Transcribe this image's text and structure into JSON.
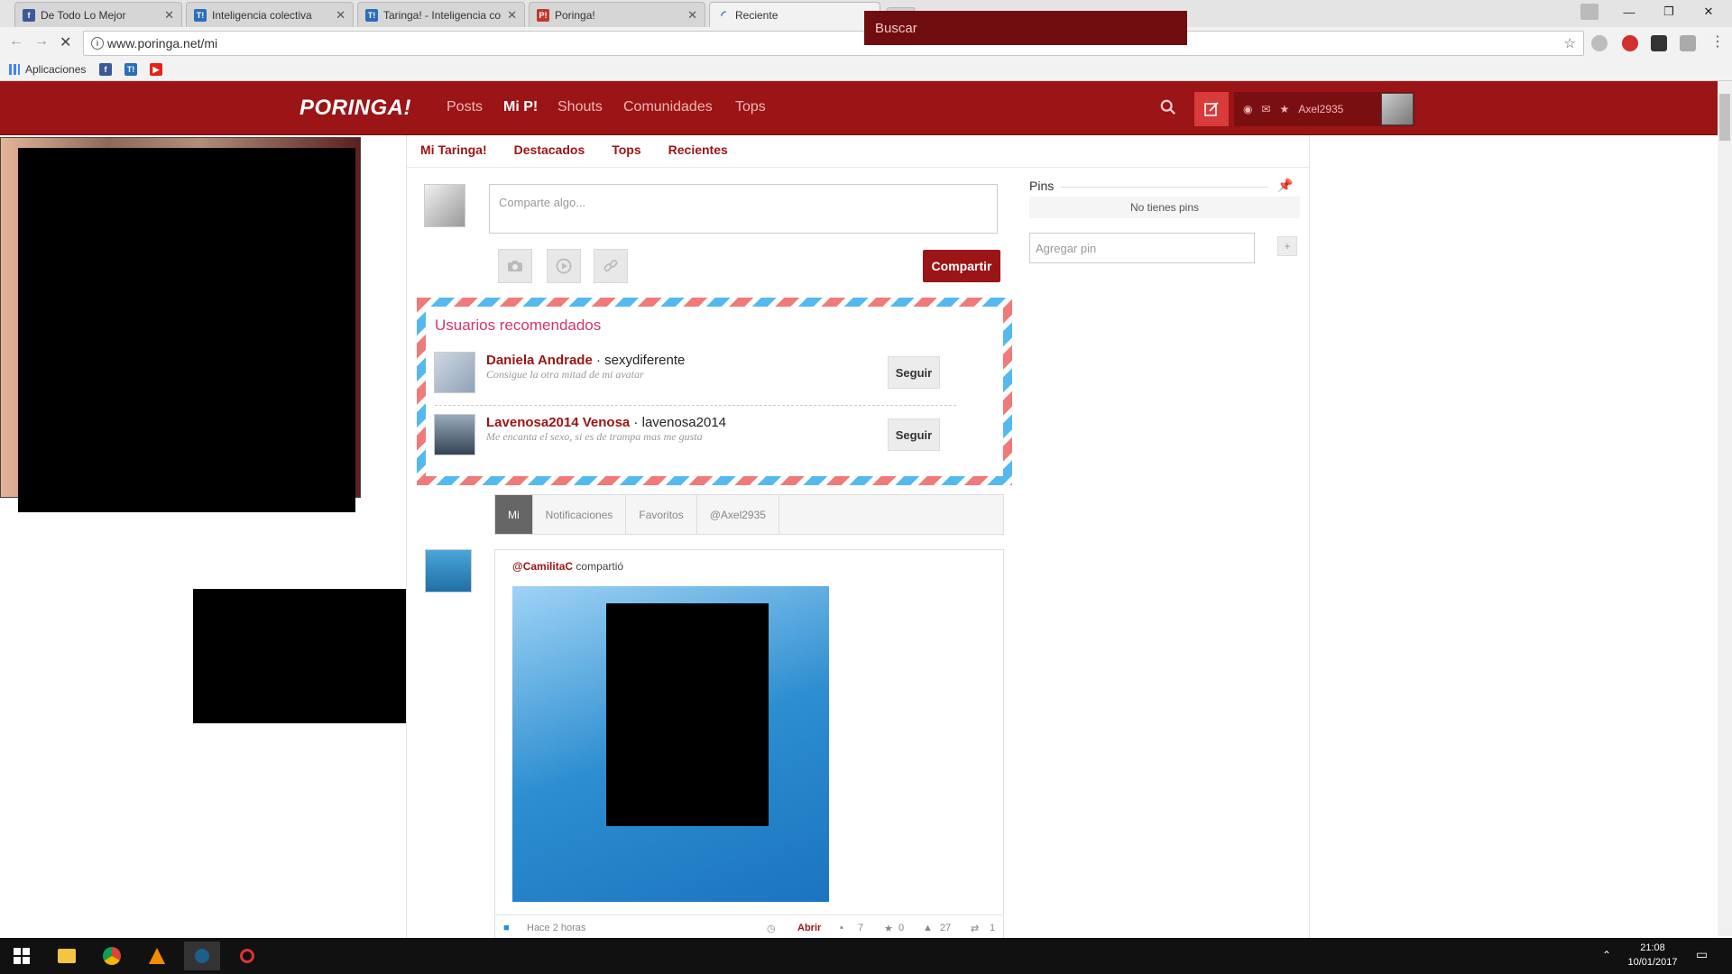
{
  "browser": {
    "tabs": [
      {
        "label": "De Todo Lo Mejor",
        "icon": "facebook-icon",
        "active": false
      },
      {
        "label": "Inteligencia colectiva",
        "icon": "taringa-icon",
        "active": false
      },
      {
        "label": "Taringa! - Inteligencia co",
        "icon": "taringa-icon",
        "active": false
      },
      {
        "label": "Poringa!",
        "icon": "poringa-icon",
        "active": false
      },
      {
        "label": "Reciente",
        "icon": "loading-icon",
        "active": true
      }
    ],
    "url": "www.poringa.net/mi",
    "bookmarks": {
      "apps_label": "Aplicaciones"
    }
  },
  "site": {
    "logo": "PORINGA!",
    "nav": [
      "Posts",
      "Mi P!",
      "Shouts",
      "Comunidades",
      "Tops"
    ],
    "active_nav": "Mi P!",
    "search_placeholder": "Buscar",
    "username": "Axel2935",
    "subnav": [
      "Mi Taringa!",
      "Destacados",
      "Tops",
      "Recientes"
    ]
  },
  "composer": {
    "placeholder": "Comparte algo...",
    "share_label": "Compartir"
  },
  "recommended": {
    "title": "Usuarios recomendados",
    "users": [
      {
        "name": "Daniela Andrade",
        "handle": "sexydiferente",
        "desc": "Consigue la otra mitad de mi avatar",
        "follow_label": "Seguir"
      },
      {
        "name": "Lavenosa2014 Venosa",
        "handle": "lavenosa2014",
        "desc": "Me encanta el sexo, si es de trampa mas me gusta",
        "follow_label": "Seguir"
      }
    ]
  },
  "feed": {
    "tabs": [
      "Mi",
      "Notificaciones",
      "Favoritos",
      "@Axel2935"
    ],
    "post": {
      "author": "@CamilitaC",
      "action": "compartió",
      "time": "Hace 2 horas",
      "open_label": "Abrir",
      "comments": "7",
      "favorites": "0",
      "likes": "27",
      "reshares": "1"
    }
  },
  "pins": {
    "title": "Pins",
    "empty_text": "No tienes pins",
    "input_placeholder": "Agregar pin",
    "add_label": "+"
  },
  "taskbar": {
    "time": "21:08",
    "date": "10/01/2017"
  },
  "colors": {
    "brand": "#9b1416",
    "brand_dark": "#6f0d0f",
    "accent_pink": "#d6336c"
  }
}
